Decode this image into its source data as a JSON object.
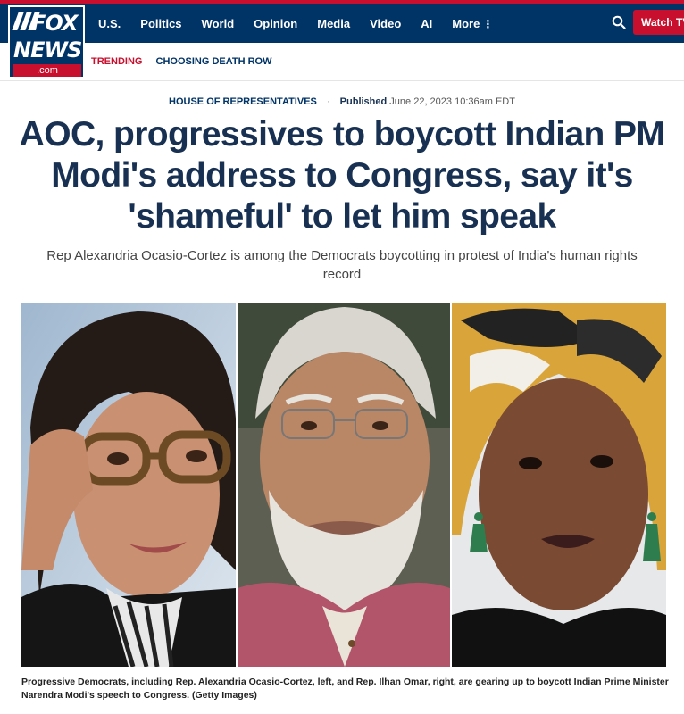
{
  "header": {
    "logo": {
      "line1": "FOX",
      "line2": "NEWS",
      "domain": ".com"
    },
    "nav": [
      "U.S.",
      "Politics",
      "World",
      "Opinion",
      "Media",
      "Video",
      "AI",
      "More"
    ],
    "more_icon": "vertical-dots-icon",
    "search_icon": "search-icon",
    "watch_tv_label": "Watch TV"
  },
  "trending": {
    "label": "TRENDING",
    "topic": "CHOOSING DEATH ROW"
  },
  "article": {
    "section": "HOUSE OF REPRESENTATIVES",
    "published_label": "Published",
    "published_date": "June 22, 2023 10:36am EDT",
    "headline_lines": [
      "AOC, progressives to boycott Indian PM",
      "Modi's address to Congress, say it's",
      "'shameful' to let him speak"
    ],
    "subheadline": "Rep Alexandria Ocasio-Cortez is among the Democrats boycotting in protest of India's human rights record",
    "caption": "Progressive Democrats, including Rep. Alexandria Ocasio-Cortez, left, and Rep. Ilhan Omar, right, are gearing up to boycott Indian Prime Minister Narendra Modi's speech to Congress. (Getty Images)"
  },
  "colors": {
    "brand_navy": "#003366",
    "brand_red": "#c8102e",
    "headline": "#183153"
  }
}
